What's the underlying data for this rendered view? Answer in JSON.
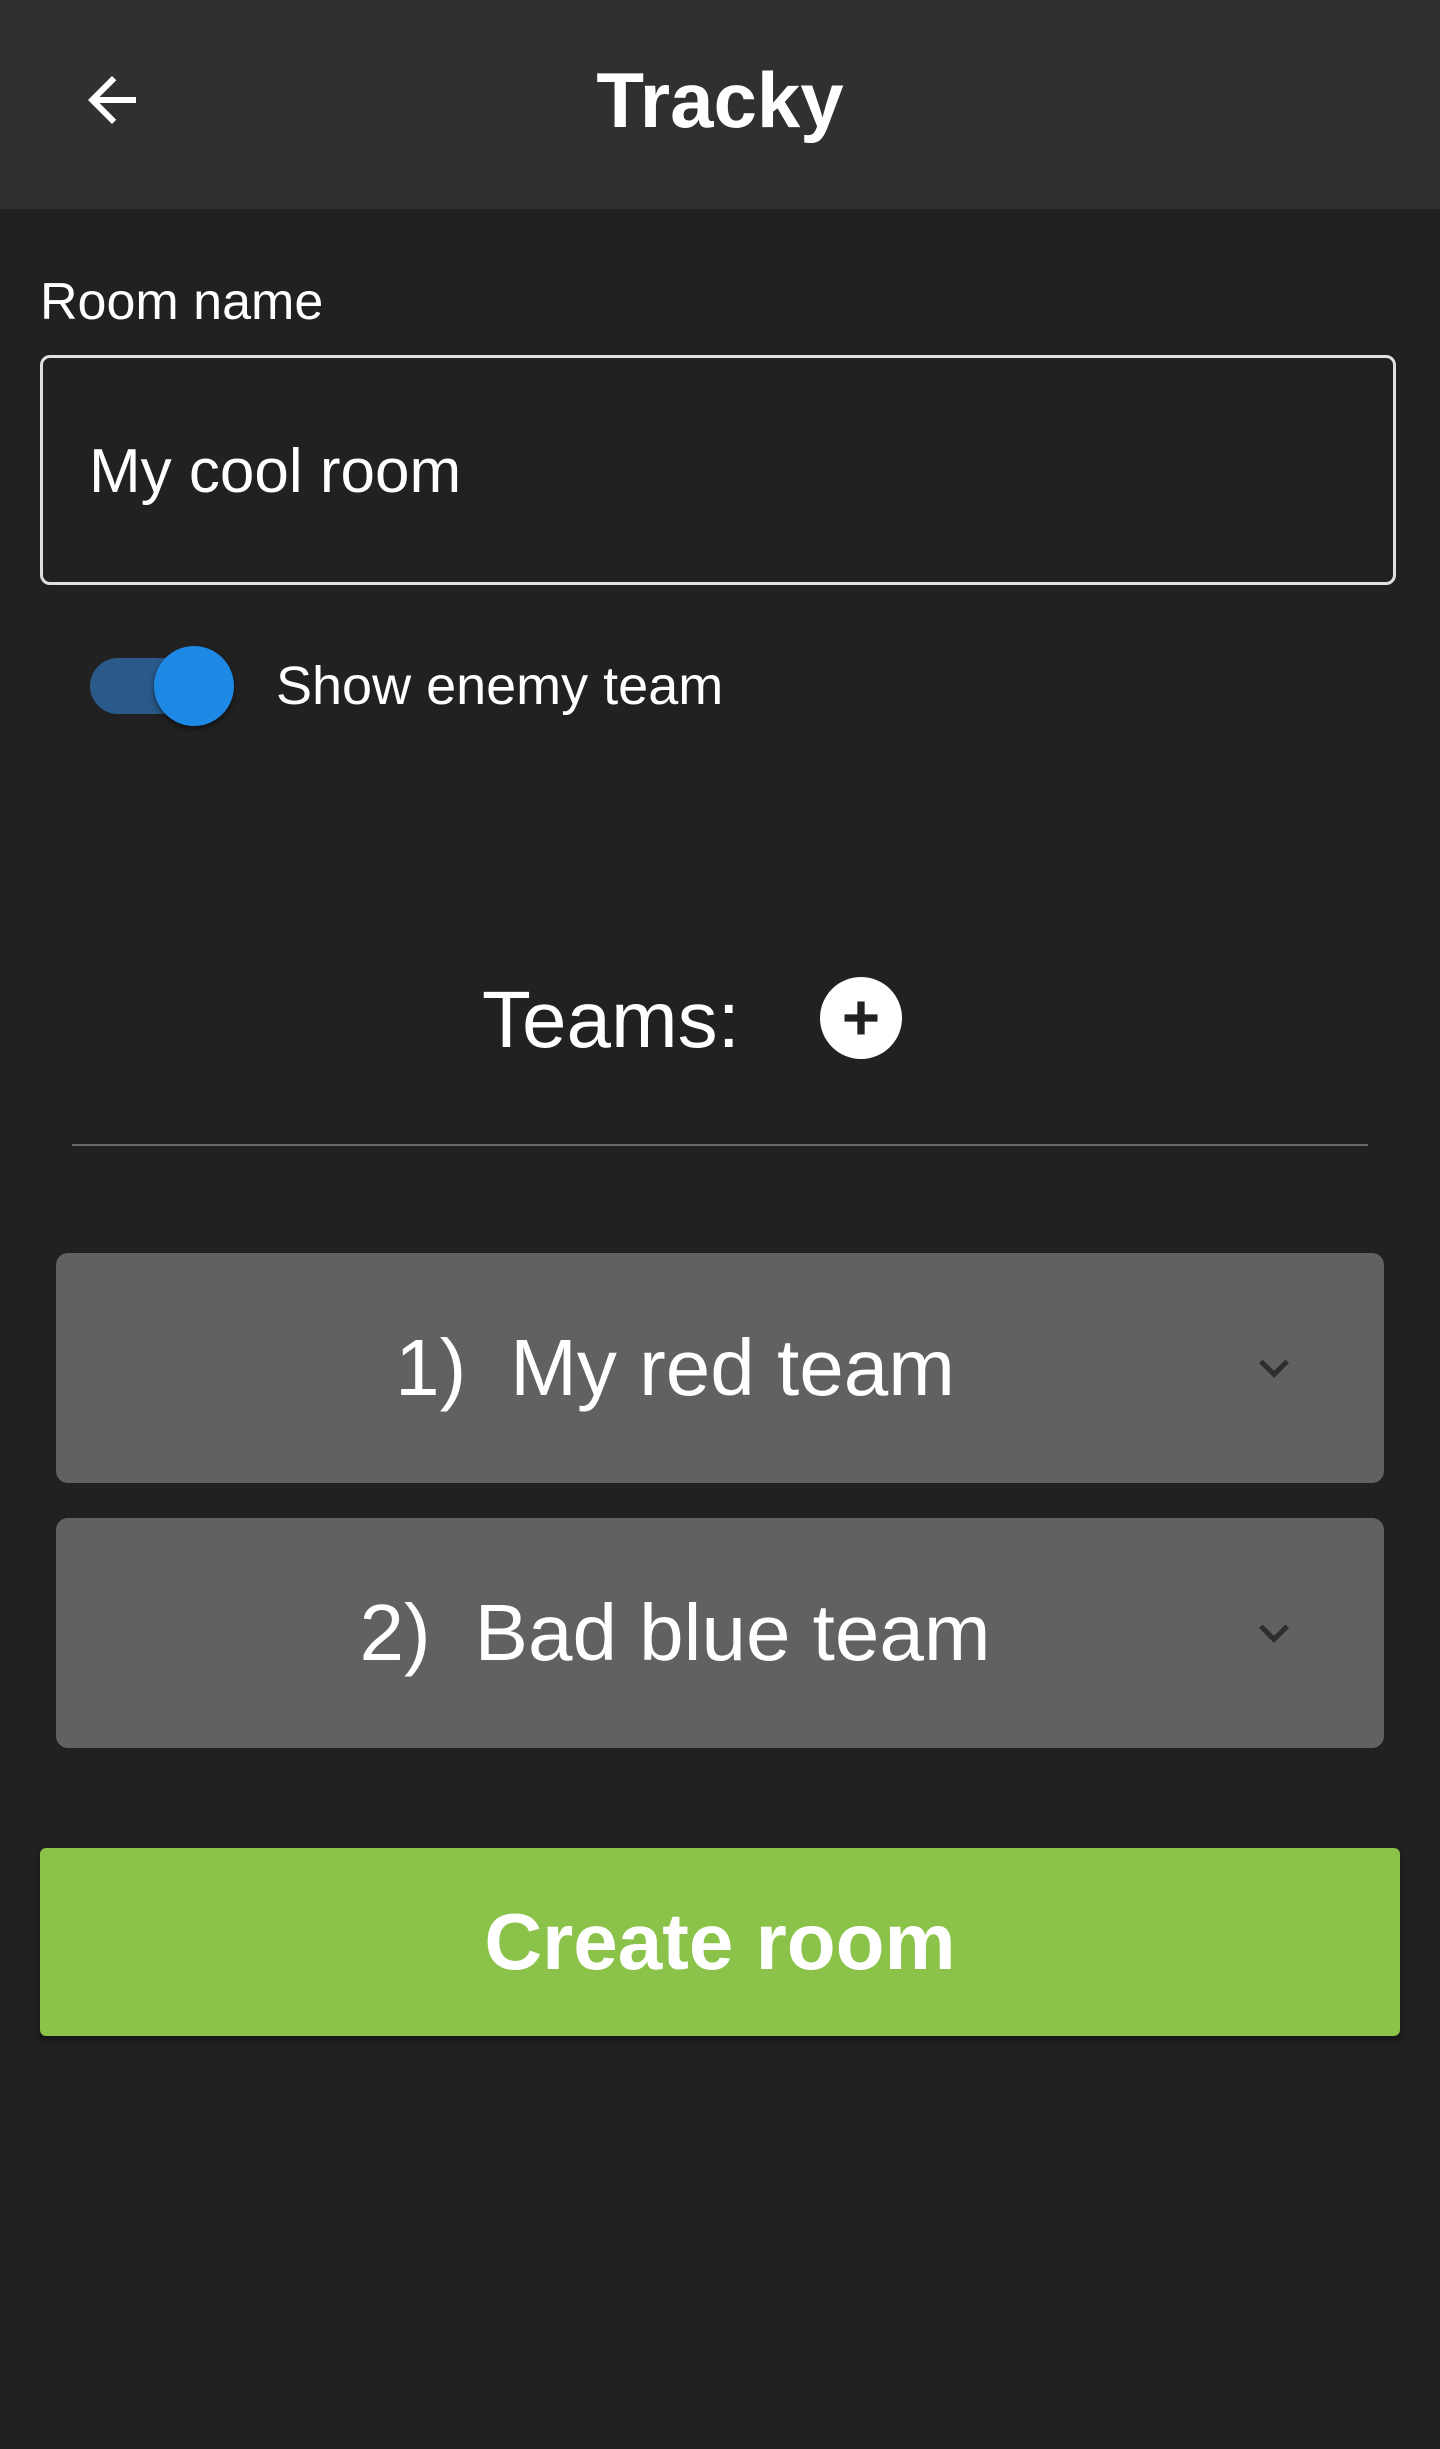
{
  "app_bar": {
    "title": "Tracky",
    "back_icon": "arrow-left-icon",
    "background": "#303030"
  },
  "room_name": {
    "label": "Room name",
    "value": "My cool room",
    "placeholder": ""
  },
  "enemy_toggle": {
    "label": "Show enemy team",
    "checked": true,
    "accent": "#1e88e5"
  },
  "teams": {
    "heading": "Teams:",
    "add_icon": "plus-circle-icon",
    "items": [
      {
        "number": "1)",
        "name": "My red team",
        "expand_icon": "chevron-down-icon"
      },
      {
        "number": "2)",
        "name": "Bad blue team",
        "expand_icon": "chevron-down-icon"
      }
    ],
    "card_color": "#616161"
  },
  "create_button": {
    "label": "Create room",
    "color": "#8bc34a"
  },
  "theme": {
    "background": "#212121",
    "text": "#ffffff"
  }
}
